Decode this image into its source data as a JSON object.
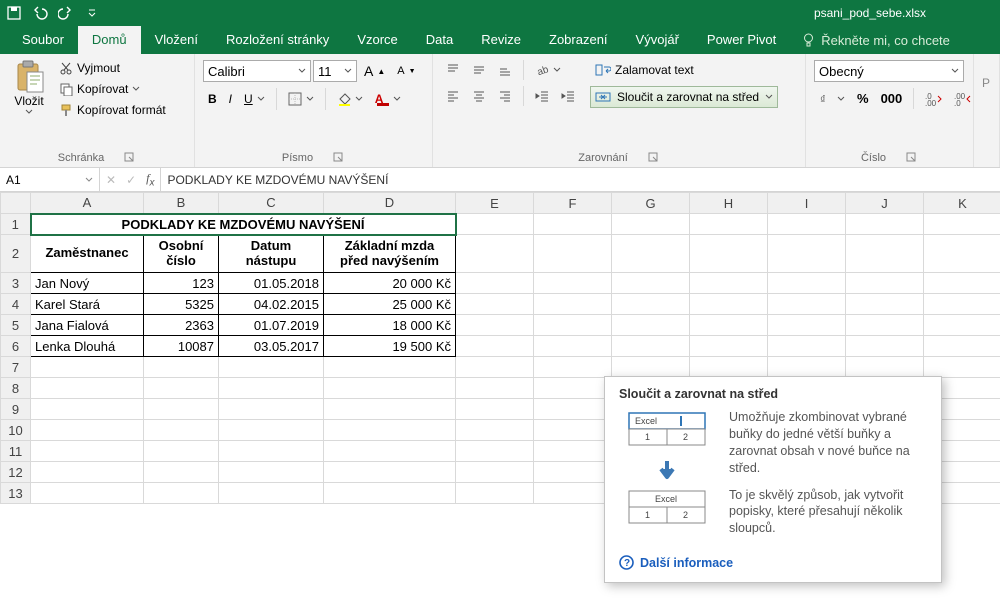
{
  "app": {
    "filename": "psani_pod_sebe.xlsx"
  },
  "qat": {
    "save": "save-icon",
    "undo": "undo-icon",
    "redo": "redo-icon"
  },
  "tabs": {
    "items": [
      "Soubor",
      "Domů",
      "Vložení",
      "Rozložení stránky",
      "Vzorce",
      "Data",
      "Revize",
      "Zobrazení",
      "Vývojář",
      "Power Pivot"
    ],
    "active_index": 1,
    "tellme": "Řekněte mi, co chcete"
  },
  "ribbon": {
    "clipboard": {
      "paste": "Vložit",
      "cut": "Vyjmout",
      "copy": "Kopírovat",
      "format_painter": "Kopírovat formát",
      "label": "Schránka"
    },
    "font": {
      "name": "Calibri",
      "size": "11",
      "label": "Písmo"
    },
    "alignment": {
      "wrap": "Zalamovat text",
      "merge": "Sloučit a zarovnat na střed",
      "label": "Zarovnání"
    },
    "number": {
      "format": "Obecný",
      "label": "Číslo"
    }
  },
  "namebox": {
    "ref": "A1"
  },
  "formula_bar": {
    "value": "PODKLADY KE MZDOVÉMU NAVÝŠENÍ"
  },
  "columns": [
    "A",
    "B",
    "C",
    "D",
    "E",
    "F",
    "G",
    "H",
    "I",
    "J",
    "K"
  ],
  "sheet": {
    "title": "PODKLADY KE MZDOVÉMU NAVÝŠENÍ",
    "headers": {
      "a": "Zaměstnanec",
      "b": "Osobní číslo",
      "c": "Datum nástupu",
      "d": "Základní mzda před navýšením"
    },
    "rows": [
      {
        "a": "Jan Nový",
        "b": "123",
        "c": "01.05.2018",
        "d": "20 000 Kč"
      },
      {
        "a": "Karel Stará",
        "b": "5325",
        "c": "04.02.2015",
        "d": "25 000 Kč"
      },
      {
        "a": "Jana Fialová",
        "b": "2363",
        "c": "01.07.2019",
        "d": "18 000 Kč"
      },
      {
        "a": "Lenka Dlouhá",
        "b": "10087",
        "c": "03.05.2017",
        "d": "19 500 Kč"
      }
    ]
  },
  "tooltip": {
    "title": "Sloučit a zarovnat na střed",
    "p1": "Umožňuje zkombinovat vybrané buňky do jedné větší buňky a zarovnat obsah v nové buňce na střed.",
    "p2": "To je skvělý způsob, jak vytvořit popisky, které přesahují několik sloupců.",
    "more": "Další informace",
    "illus_label": "Excel"
  }
}
